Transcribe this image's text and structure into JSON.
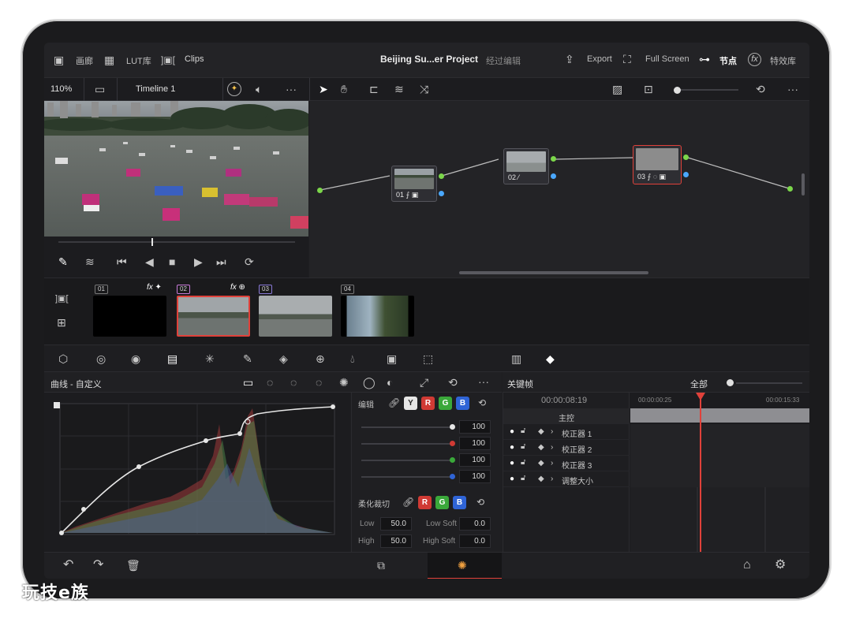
{
  "topbar": {
    "media_label": "画廊",
    "lut_label": "LUT库",
    "clips_label": "Clips",
    "project_title": "Beijing Su...er Project",
    "project_status": "经过编辑",
    "export_label": "Export",
    "fullscreen_label": "Full Screen",
    "nodes_label": "节点",
    "effects_label": "特效库"
  },
  "toolbar2": {
    "zoom": "110%",
    "timeline": "Timeline 1",
    "more": "···",
    "more2": "···"
  },
  "nodes": [
    {
      "id": "node-01",
      "label": "01 ⨍ ▣"
    },
    {
      "id": "node-02",
      "label": "02 ⁄"
    },
    {
      "id": "node-03",
      "label": "03 ⨍ ◌ ▣"
    }
  ],
  "clips": [
    {
      "num": "01",
      "fx": "fx ✦"
    },
    {
      "num": "02",
      "fx": "fx ⊕"
    },
    {
      "num": "03",
      "fx": ""
    },
    {
      "num": "04",
      "fx": ""
    }
  ],
  "curves": {
    "title": "曲线 - 自定义",
    "edit_label": "编辑",
    "channels": [
      "Y",
      "R",
      "G",
      "B"
    ],
    "values": [
      "100",
      "100",
      "100",
      "100"
    ],
    "soft_clip_label": "柔化裁切",
    "soft_channels": [
      "R",
      "G",
      "B"
    ],
    "low_label": "Low",
    "low_value": "50.0",
    "high_label": "High",
    "high_value": "50.0",
    "low_soft_label": "Low Soft",
    "low_soft_value": "0.0",
    "high_soft_label": "High Soft",
    "high_soft_value": "0.0",
    "more": "···"
  },
  "keyframes": {
    "title": "关键帧",
    "scope": "全部",
    "timecode": "00:00:08:19",
    "ruler_start": "00:00:00:25",
    "ruler_end": "00:00:15:33",
    "master": "主控",
    "tracks": [
      "校正器 1",
      "校正器 2",
      "校正器 3",
      "调整大小"
    ]
  },
  "colors": {
    "accent_red": "#e0413a",
    "node_green": "#7bd64a",
    "node_blue": "#4aa8ff"
  },
  "watermark": "玩技e族"
}
